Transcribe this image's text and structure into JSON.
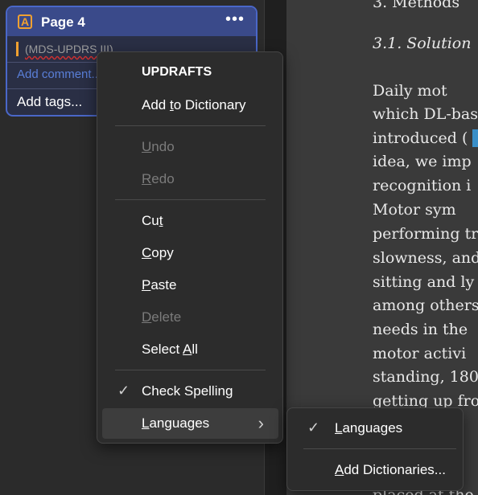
{
  "card": {
    "title": "Page 4",
    "quote": "(MDS-UPDRS III)",
    "comment_placeholder": "Add comment...",
    "tags_label": "Add tags...",
    "annotation_icon": "A",
    "more_icon": "•••",
    "accent_color": "#4a67c8"
  },
  "document": {
    "line1": "3.  Methods",
    "heading": "3.1.  Solution",
    "lines": [
      "    Daily mot",
      "which DL-bas",
      "introduced ( ",
      "idea, we imp",
      "recognition i",
      "    Motor sym",
      "performing tr",
      "slowness, and",
      "sitting and ly",
      "among others",
      "needs in the ",
      "motor activi",
      "standing, 180",
      "getting up fro",
      "placed at the"
    ]
  },
  "context_menu": {
    "spelling_word": "UPDRAFTS",
    "add_to_dictionary": {
      "pre": "Add ",
      "acc": "t",
      "post": "o Dictionary"
    },
    "undo": {
      "acc": "U",
      "post": "ndo"
    },
    "redo": {
      "acc": "R",
      "post": "edo"
    },
    "cut": {
      "pre": "Cu",
      "acc": "t"
    },
    "copy": {
      "acc": "C",
      "post": "opy"
    },
    "paste": {
      "acc": "P",
      "post": "aste"
    },
    "delete": {
      "acc": "D",
      "post": "elete"
    },
    "select_all": {
      "pre": "Select ",
      "acc": "A",
      "post": "ll"
    },
    "check_spelling": "Check Spelling",
    "languages": {
      "acc": "L",
      "post": "anguages"
    },
    "check_icon": "✓",
    "chevron_icon": "›"
  },
  "submenu": {
    "languages": {
      "acc": "L",
      "post": "anguages"
    },
    "add_dictionaries": {
      "acc": "A",
      "post": "dd Dictionaries..."
    },
    "check_icon": "✓"
  }
}
